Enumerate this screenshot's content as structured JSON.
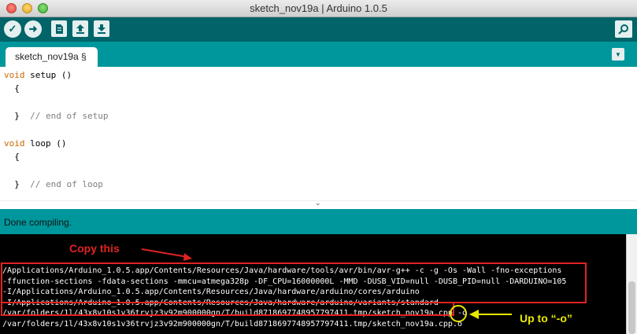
{
  "window": {
    "title": "sketch_nov19a | Arduino 1.0.5"
  },
  "toolbar": {
    "verify_icon": "check-icon",
    "upload_icon": "arrow-right-icon",
    "new_icon": "document-icon",
    "open_icon": "upload-arrow-icon",
    "save_icon": "download-arrow-icon",
    "serial_monitor_icon": "magnifier-icon"
  },
  "tabs": [
    {
      "label": "sketch_nov19a §"
    }
  ],
  "editor": {
    "lines": [
      {
        "kw": "void",
        "name": " setup",
        "rest": " ()"
      },
      {
        "text": "  {"
      },
      {
        "text": ""
      },
      {
        "text": "  }  ",
        "comment": "// end of setup"
      },
      {
        "text": ""
      },
      {
        "kw": "void",
        "name": " loop",
        "rest": " ()"
      },
      {
        "text": "  {"
      },
      {
        "text": ""
      },
      {
        "text": "  }  ",
        "comment": "// end of loop"
      }
    ]
  },
  "status": {
    "message": "Done compiling."
  },
  "console": {
    "lines": [
      "/Applications/Arduino_1.0.5.app/Contents/Resources/Java/hardware/tools/avr/bin/avr-g++ -c -g -Os -Wall -fno-exceptions",
      "-ffunction-sections -fdata-sections -mmcu=atmega328p -DF_CPU=16000000L -MMD -DUSB_VID=null -DUSB_PID=null -DARDUINO=105",
      "-I/Applications/Arduino_1.0.5.app/Contents/Resources/Java/hardware/arduino/cores/arduino",
      "-I/Applications/Arduino_1.0.5.app/Contents/Resources/Java/hardware/arduino/variants/standard",
      "/var/folders/1l/43x8v10s1v36trvjz3v92m900000gn/T/build8718697748957797411.tmp/sketch_nov19a.cpp -o",
      "/var/folders/1l/43x8v10s1v36trvjz3v92m900000gn/T/build8718697748957797411.tmp/sketch_nov19a.cpp.o"
    ]
  },
  "annotations": {
    "copy_label": "Copy this",
    "upto_label": "Up to “-o”",
    "red": "#e02222",
    "yellow": "#e8e800"
  },
  "colors": {
    "toolbar": "#006468",
    "tabstrip": "#00979c",
    "keyword": "#cc6600",
    "comment": "#7e7e7e"
  }
}
